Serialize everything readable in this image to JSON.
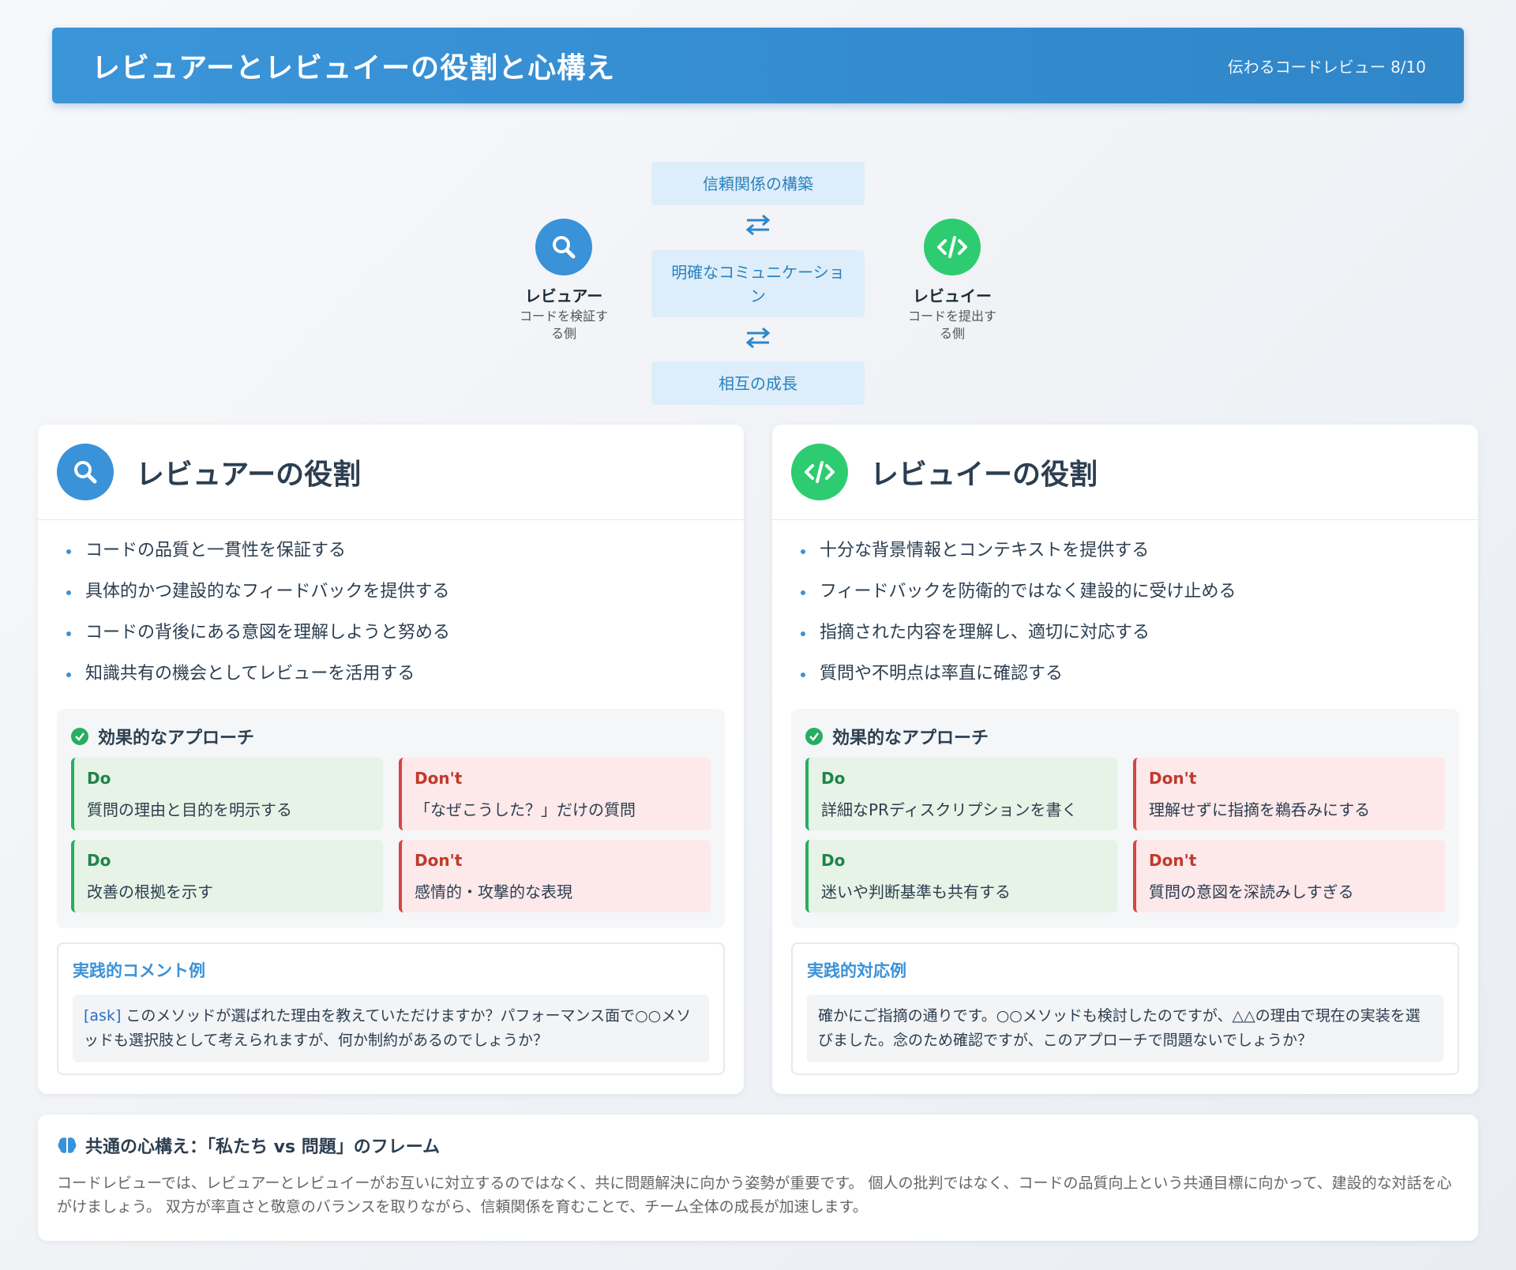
{
  "header": {
    "title": "レビュアーとレビュイーの役割と心構え",
    "page": "伝わるコードレビュー 8/10"
  },
  "diagram": {
    "reviewer": {
      "name": "レビュアー",
      "desc_line1": "コードを検証す",
      "desc_line2": "る側",
      "icon": "search-icon"
    },
    "reviewee": {
      "name": "レビュイー",
      "desc_line1": "コードを提出す",
      "desc_line2": "る側",
      "icon": "code-icon"
    },
    "center": [
      "信頼関係の構築",
      "明確なコミュニケーション",
      "相互の成長"
    ],
    "accent_blue": "#3a92d8",
    "accent_green": "#2ecc71"
  },
  "reviewer_card": {
    "title": "レビュアーの役割",
    "bullets": [
      "コードの品質と一貫性を保証する",
      "具体的かつ建設的なフィードバックを提供する",
      "コードの背後にある意図を理解しようと努める",
      "知識共有の機会としてレビューを活用する"
    ],
    "approach_title": "効果的なアプローチ",
    "do_label": "Do",
    "dont_label": "Don't",
    "do1": "質問の理由と目的を明示する",
    "dont1": "「なぜこうした？」だけの質問",
    "do2": "改善の根拠を示す",
    "dont2": "感情的・攻撃的な表現",
    "example_title": "実践的コメント例",
    "example_tag": "[ask]",
    "example_text": " このメソッドが選ばれた理由を教えていただけますか？パフォーマンス面で○○メソッドも選択肢として考えられますが、何か制約があるのでしょうか？"
  },
  "reviewee_card": {
    "title": "レビュイーの役割",
    "bullets": [
      "十分な背景情報とコンテキストを提供する",
      "フィードバックを防衛的ではなく建設的に受け止める",
      "指摘された内容を理解し、適切に対応する",
      "質問や不明点は率直に確認する"
    ],
    "approach_title": "効果的なアプローチ",
    "do_label": "Do",
    "dont_label": "Don't",
    "do1": "詳細なPRディスクリプションを書く",
    "dont1": "理解せずに指摘を鵜呑みにする",
    "do2": "迷いや判断基準も共有する",
    "dont2": "質問の意図を深読みしすぎる",
    "example_title": "実践的対応例",
    "example_text": "確かにご指摘の通りです。○○メソッドも検討したのですが、△△の理由で現在の実装を選びました。念のため確認ですが、このアプローチで問題ないでしょうか？"
  },
  "footer": {
    "title": "共通の心構え：「私たち vs 問題」のフレーム",
    "icon": "brain-icon",
    "text": "コードレビューでは、レビュアーとレビュイーがお互いに対立するのではなく、共に問題解決に向かう姿勢が重要です。 個人の批判ではなく、コードの品質向上という共通目標に向かって、建設的な対話を心がけましょう。 双方が率直さと敬意のバランスを取りながら、信頼関係を育むことで、チーム全体の成長が加速します。"
  }
}
